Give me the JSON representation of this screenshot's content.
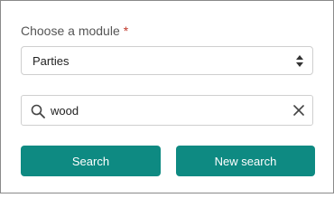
{
  "form": {
    "module_label": "Choose a module",
    "required_marker": "*",
    "module_selected": "Parties",
    "search_query": "wood",
    "search_button_label": "Search",
    "new_search_button_label": "New search"
  },
  "icons": {
    "select": "sort-updown-icon",
    "search": "magnifier-icon",
    "clear": "close-x-icon"
  },
  "colors": {
    "primary_button": "#0e8a82",
    "required_marker": "#c0392b"
  }
}
